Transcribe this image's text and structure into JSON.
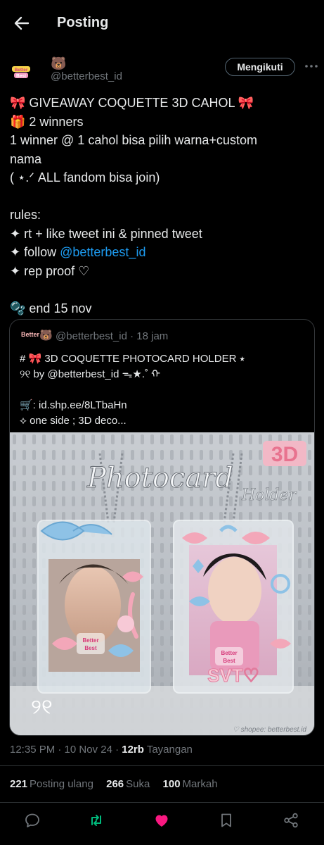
{
  "header": {
    "title": "Posting"
  },
  "author": {
    "logo_text_1": "Better",
    "logo_text_2": "Best",
    "name_emoji": "🐻",
    "handle": "@betterbest_id",
    "follow_label": "Mengikuti"
  },
  "tweet": {
    "line1": "🎀 GIVEAWAY COQUETTE 3D CAHOL 🎀",
    "line2": "🎁 2 winners",
    "line3": "1 winner @ 1 cahol bisa pilih warna+custom",
    "line4": "nama",
    "line5": "( ⋆.ᐟ ALL fandom bisa join)",
    "line6": "rules:",
    "line7": "✦ rt + like tweet ini & pinned tweet",
    "line8_prefix": "✦ follow ",
    "line8_mention": "@betterbest_id",
    "line9": "✦ rep proof ♡",
    "line10": "🫧 end 15 nov"
  },
  "quote": {
    "avatar_text": "Better",
    "name_emoji": "🐻",
    "handle_time": "@betterbest_id · 18 jam",
    "line1": "# 🎀 3D COQUETTE PHOTOCARD HOLDER ⭑",
    "line2": "     ୨୧ by @betterbest_id ᯓ★.˚ ᡣ",
    "line3": "🛒: id.shp.ee/8LTbaHn",
    "line4": "⟡ one side ; 3D deco...",
    "image": {
      "badge": "3D",
      "script_title": "Photocard",
      "script_sub": "Holder",
      "card_logo_1": "Better",
      "card_logo_2": "Best",
      "svt_text": "SVT♡",
      "corner_mark": "୨୧",
      "watermark": "♡ shopee: betterbest.id"
    }
  },
  "meta": {
    "time_date": "12:35 PM · 10 Nov 24 · ",
    "views_count": "12rb",
    "views_label": " Tayangan"
  },
  "stats": {
    "reposts_count": "221",
    "reposts_label": "Posting ulang",
    "likes_count": "266",
    "likes_label": "Suka",
    "bookmarks_count": "100",
    "bookmarks_label": "Markah"
  },
  "colors": {
    "accent": "#1d9bf0",
    "like": "#f91880",
    "repost": "#00ba7c",
    "muted": "#71767b"
  },
  "icons": [
    "back-arrow-icon",
    "reply-icon",
    "repost-icon",
    "like-icon",
    "bookmark-icon",
    "share-icon"
  ]
}
